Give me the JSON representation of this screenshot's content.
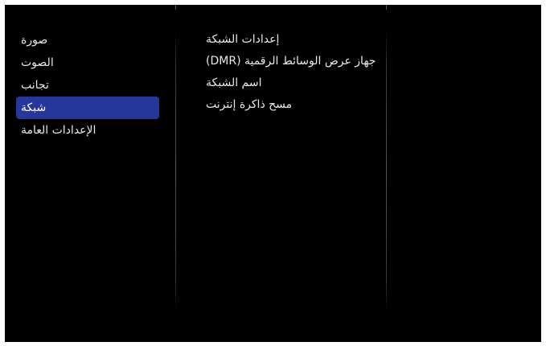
{
  "left_menu": {
    "items": [
      {
        "label": "صورة"
      },
      {
        "label": "الصوت"
      },
      {
        "label": "تجانب"
      },
      {
        "label": "شبكة"
      },
      {
        "label": "الإعدادات العامة"
      }
    ],
    "selected_index": 3
  },
  "network_menu": {
    "items": [
      {
        "label": "إعدادات الشبكة"
      },
      {
        "label": "جهاز عرض الوسائط الرقمية (DMR)"
      },
      {
        "label": "اسم الشبكة"
      },
      {
        "label": "مسح ذاكرة إنترنت"
      }
    ]
  },
  "colors": {
    "background": "#000000",
    "selection": "#26379a",
    "text": "#e8e8e8"
  }
}
